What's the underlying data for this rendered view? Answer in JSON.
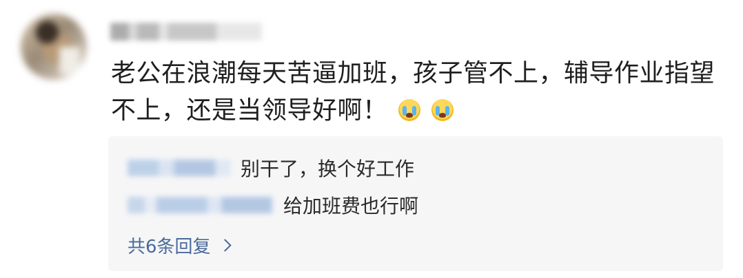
{
  "comment": {
    "text": "老公在浪潮每天苦逼加班，孩子管不上，辅导作业指望不上，还是当领导好啊！",
    "emojis": [
      "crying-face-icon",
      "crying-face-icon"
    ]
  },
  "replies": [
    {
      "text": "别干了，换个好工作"
    },
    {
      "text": "给加班费也行啊"
    }
  ],
  "more_replies": {
    "label": "共6条回复"
  },
  "colors": {
    "link": "#4a6a9a",
    "reply_bg": "#f6f6f7",
    "text": "#1f1f1f"
  }
}
